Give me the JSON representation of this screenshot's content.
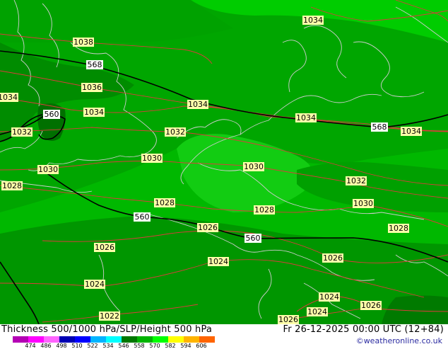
{
  "footer": {
    "title": "Thickness 500/1000 hPa/SLP/Height 500 hPa",
    "datetime": "Fr 26-12-2025 00:00 UTC (12+84)",
    "credit": "©weatheronline.co.uk"
  },
  "legend": {
    "ticks": [
      "474",
      "486",
      "498",
      "510",
      "522",
      "534",
      "546",
      "558",
      "570",
      "582",
      "594",
      "606"
    ],
    "colors": [
      "#b400b4",
      "#ff00ff",
      "#ff64ff",
      "#0000b4",
      "#0000ff",
      "#00b4ff",
      "#00ffff",
      "#007800",
      "#00b400",
      "#00ff00",
      "#ffff00",
      "#ffb400",
      "#ff6400"
    ]
  },
  "colors": {
    "fill_light": "#00c800",
    "fill_mid": "#00a000",
    "fill_dark": "#008200",
    "fill_pale": "#16d416",
    "isobar": "#dc3c3c",
    "coast": "#c8c8c8",
    "height_line": "#000000"
  },
  "isobar_labels": [
    "1034",
    "1038",
    "1036",
    "1034",
    "1034",
    "1034",
    "1034",
    "1034",
    "1032",
    "1032",
    "1030",
    "1030",
    "1032",
    "1030",
    "1028",
    "1028",
    "1028",
    "1026",
    "1026",
    "1028",
    "1024",
    "1026",
    "1024",
    "1024",
    "1026",
    "1022",
    "1026",
    "1024",
    "1030"
  ],
  "height_labels": [
    "568",
    "568",
    "560",
    "560",
    "560"
  ]
}
